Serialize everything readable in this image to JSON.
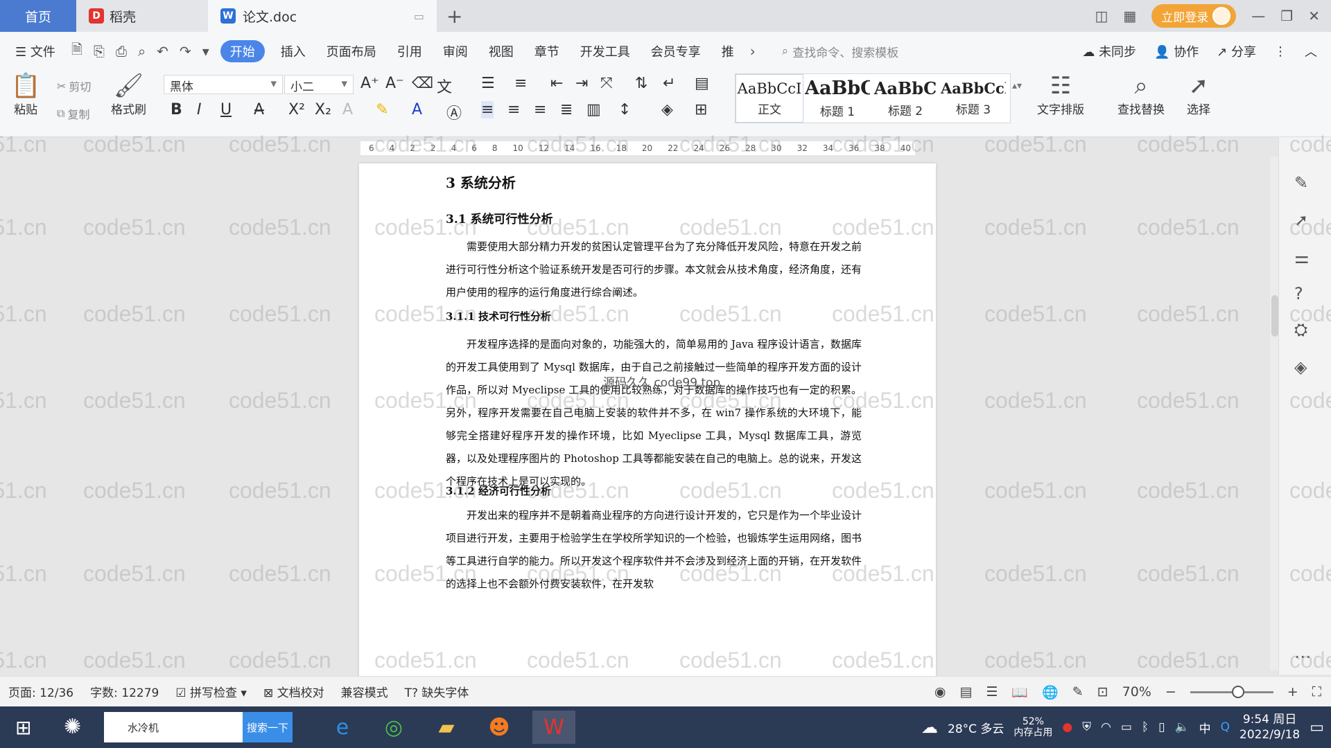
{
  "tabs": {
    "home": "首页",
    "daoke": "稻壳",
    "doc": "论文.doc"
  },
  "titlebar": {
    "login": "立即登录"
  },
  "menu": {
    "file": "文件",
    "items": [
      "开始",
      "插入",
      "页面布局",
      "引用",
      "审阅",
      "视图",
      "章节",
      "开发工具",
      "会员专享",
      "推"
    ],
    "search": "查找命令、搜索模板",
    "sync": "未同步",
    "collab": "协作",
    "share": "分享"
  },
  "ribbon": {
    "paste": "粘贴",
    "cut": "剪切",
    "copy": "复制",
    "format_painter": "格式刷",
    "font": "黑体",
    "size": "小二",
    "styles": [
      {
        "sample": "AaBbCcI",
        "name": "正文"
      },
      {
        "sample": "AaBbC",
        "name": "标题 1"
      },
      {
        "sample": "AaBbC",
        "name": "标题 2"
      },
      {
        "sample": "AaBbCcl",
        "name": "标题 3"
      }
    ],
    "text_layout": "文字排版",
    "find_replace": "查找替换",
    "select": "选择"
  },
  "ruler": {
    "ticks": [
      "6",
      "4",
      "2",
      "2",
      "4",
      "6",
      "8",
      "10",
      "12",
      "14",
      "16",
      "18",
      "20",
      "22",
      "24",
      "26",
      "28",
      "30",
      "32",
      "34",
      "36",
      "38",
      "40"
    ]
  },
  "document": {
    "h1": "3  系统分析",
    "h2": "3.1 系统可行性分析",
    "p1": "需要使用大部分精力开发的贫困认定管理平台为了充分降低开发风险，特意在开发之前进行可行性分析这个验证系统开发是否可行的步骤。本文就会从技术角度，经济角度，还有用户使用的程序的运行角度进行综合阐述。",
    "h3a": "3.1.1  技术可行性分析",
    "overlay": "源码久久 code99.top",
    "p2": "开发程序选择的是面向对象的，功能强大的，简单易用的 Java 程序设计语言，数据库的开发工具使用到了 Mysql 数据库，由于自己之前接触过一些简单的程序开发方面的设计作品，所以对 Myeclipse 工具的使用比较熟练，对于数据库的操作技巧也有一定的积累。另外，程序开发需要在自己电脑上安装的软件并不多，在 win7 操作系统的大环境下，能够完全搭建好程序开发的操作环境，比如 Myeclipse 工具，Mysql 数据库工具，游览器，以及处理程序图片的 Photoshop 工具等都能安装在自己的电脑上。总的说来，开发这个程序在技术上是可以实现的。",
    "h3b": "3.1.2  经济可行性分析",
    "p3": "开发出来的程序并不是朝着商业程序的方向进行设计开发的，它只是作为一个毕业设计项目进行开发，主要用于检验学生在学校所学知识的一个检验，也锻炼学生运用网络，图书等工具进行自学的能力。所以开发这个程序软件并不会涉及到经济上面的开销，在开发软件的选择上也不会额外付费安装软件，在开发软"
  },
  "watermark": "code51.cn",
  "status": {
    "page": "页面: 12/36",
    "words": "字数: 12279",
    "spell": "拼写检查",
    "proof": "文档校对",
    "compat": "兼容模式",
    "missing_font": "缺失字体",
    "zoom": "70%"
  },
  "taskbar": {
    "search_text": "水冷机",
    "search_btn": "搜索一下",
    "weather": "28°C 多云",
    "mem": "52%",
    "mem_label": "内存占用",
    "ime": "中",
    "time": "9:54 周日",
    "date": "2022/9/18"
  }
}
